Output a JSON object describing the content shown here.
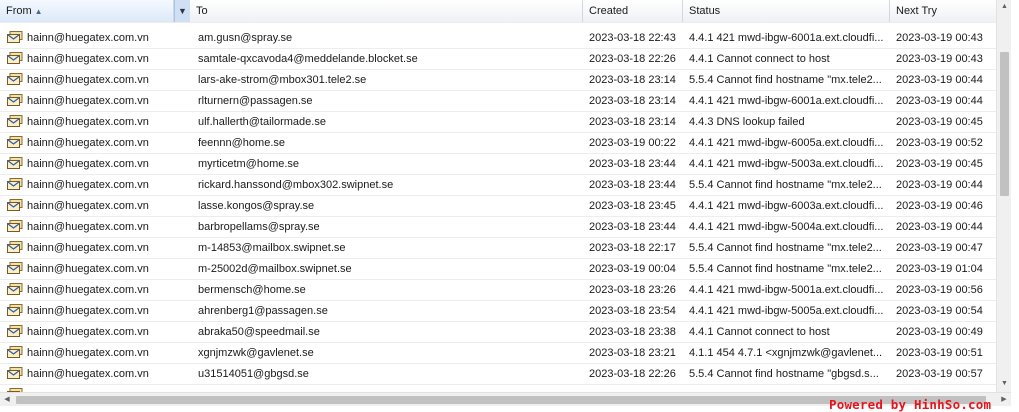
{
  "columns": {
    "from": "From",
    "to": "To",
    "created": "Created",
    "status": "Status",
    "next_try": "Next Try"
  },
  "rows": [
    {
      "from": "hainn@huegatex.com.vn",
      "to": "am.gusn@spray.se",
      "created": "2023-03-18 22:43",
      "status": "4.4.1 421 mwd-ibgw-6001a.ext.cloudfi...",
      "next_try": "2023-03-19 00:43"
    },
    {
      "from": "hainn@huegatex.com.vn",
      "to": "samtale-qxcavoda4@meddelande.blocket.se",
      "created": "2023-03-18 22:26",
      "status": "4.4.1 Cannot connect to host",
      "next_try": "2023-03-19 00:43"
    },
    {
      "from": "hainn@huegatex.com.vn",
      "to": "lars-ake-strom@mbox301.tele2.se",
      "created": "2023-03-18 23:14",
      "status": "5.5.4 Cannot find hostname \"mx.tele2...",
      "next_try": "2023-03-19 00:44"
    },
    {
      "from": "hainn@huegatex.com.vn",
      "to": "rlturnern@passagen.se",
      "created": "2023-03-18 23:14",
      "status": "4.4.1 421 mwd-ibgw-6001a.ext.cloudfi...",
      "next_try": "2023-03-19 00:44"
    },
    {
      "from": "hainn@huegatex.com.vn",
      "to": "ulf.hallerth@tailormade.se",
      "created": "2023-03-18 23:14",
      "status": "4.4.3 DNS lookup failed",
      "next_try": "2023-03-19 00:45"
    },
    {
      "from": "hainn@huegatex.com.vn",
      "to": "feennn@home.se",
      "created": "2023-03-19 00:22",
      "status": "4.4.1 421 mwd-ibgw-6005a.ext.cloudfi...",
      "next_try": "2023-03-19 00:52"
    },
    {
      "from": "hainn@huegatex.com.vn",
      "to": "myrticetm@home.se",
      "created": "2023-03-18 23:44",
      "status": "4.4.1 421 mwd-ibgw-5003a.ext.cloudfi...",
      "next_try": "2023-03-19 00:45"
    },
    {
      "from": "hainn@huegatex.com.vn",
      "to": "rickard.hanssond@mbox302.swipnet.se",
      "created": "2023-03-18 23:44",
      "status": "5.5.4 Cannot find hostname \"mx.tele2...",
      "next_try": "2023-03-19 00:44"
    },
    {
      "from": "hainn@huegatex.com.vn",
      "to": "lasse.kongos@spray.se",
      "created": "2023-03-18 23:45",
      "status": "4.4.1 421 mwd-ibgw-6003a.ext.cloudfi...",
      "next_try": "2023-03-19 00:46"
    },
    {
      "from": "hainn@huegatex.com.vn",
      "to": "barbropellams@spray.se",
      "created": "2023-03-18 23:44",
      "status": "4.4.1 421 mwd-ibgw-5004a.ext.cloudfi...",
      "next_try": "2023-03-19 00:44"
    },
    {
      "from": "hainn@huegatex.com.vn",
      "to": "m-14853@mailbox.swipnet.se",
      "created": "2023-03-18 22:17",
      "status": "5.5.4 Cannot find hostname \"mx.tele2...",
      "next_try": "2023-03-19 00:47"
    },
    {
      "from": "hainn@huegatex.com.vn",
      "to": "m-25002d@mailbox.swipnet.se",
      "created": "2023-03-19 00:04",
      "status": "5.5.4 Cannot find hostname \"mx.tele2...",
      "next_try": "2023-03-19 01:04"
    },
    {
      "from": "hainn@huegatex.com.vn",
      "to": "bermensch@home.se",
      "created": "2023-03-18 23:26",
      "status": "4.4.1 421 mwd-ibgw-5001a.ext.cloudfi...",
      "next_try": "2023-03-19 00:56"
    },
    {
      "from": "hainn@huegatex.com.vn",
      "to": "ahrenberg1@passagen.se",
      "created": "2023-03-18 23:54",
      "status": "4.4.1 421 mwd-ibgw-5005a.ext.cloudfi...",
      "next_try": "2023-03-19 00:54"
    },
    {
      "from": "hainn@huegatex.com.vn",
      "to": "abraka50@speedmail.se",
      "created": "2023-03-18 23:38",
      "status": "4.4.1 Cannot connect to host",
      "next_try": "2023-03-19 00:49"
    },
    {
      "from": "hainn@huegatex.com.vn",
      "to": "xgnjmzwk@gavlenet.se",
      "created": "2023-03-18 23:21",
      "status": "4.1.1 454 4.7.1 <xgnjmzwk@gavlenet...",
      "next_try": "2023-03-19 00:51"
    },
    {
      "from": "hainn@huegatex.com.vn",
      "to": "u31514051@gbgsd.se",
      "created": "2023-03-18 22:26",
      "status": "5.5.4 Cannot find hostname \"gbgsd.s...",
      "next_try": "2023-03-19 00:57"
    }
  ],
  "icons": {
    "row": "envelope-queue-icon",
    "sort": "sort-ascending-icon",
    "menu": "column-menu-icon"
  },
  "colors": {
    "header_bg": "#eef1f5",
    "sorted_header_bg": "#dce9f8",
    "row_border": "#ededed",
    "scroll_thumb": "#c1c1c1",
    "watermark": "#e8141b"
  },
  "watermark": "Powered by HinhSo.com"
}
